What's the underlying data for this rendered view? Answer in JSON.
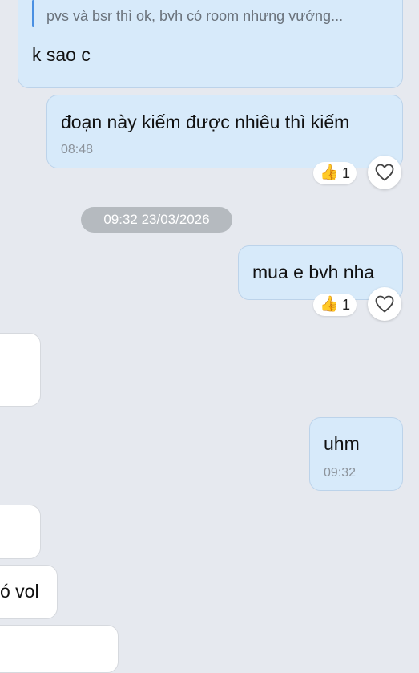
{
  "messages": {
    "quote_text": "pvs và bsr thì ok, bvh có room nhưng vướng...",
    "m1_text": "k sao c",
    "m2_text": "đoạn này kiếm được nhiêu thì kiếm",
    "m2_time": "08:48",
    "m2_reaction_emoji": "👍",
    "m2_reaction_count": "1",
    "date_separator": "09:32 23/03/2026",
    "m3_text": "mua e bvh nha",
    "m3_reaction_emoji": "👍",
    "m3_reaction_count": "1",
    "m4_text": "uhm",
    "m4_time": "09:32",
    "m5_partial_text": "ó vol"
  },
  "colors": {
    "background": "#e6e9ef",
    "outgoing_bubble": "#d7eafa",
    "incoming_bubble": "#ffffff",
    "quote_accent": "#4a90e2",
    "date_chip": "#b5babf"
  },
  "icons": {
    "reaction_button": "heart-outline-icon"
  }
}
